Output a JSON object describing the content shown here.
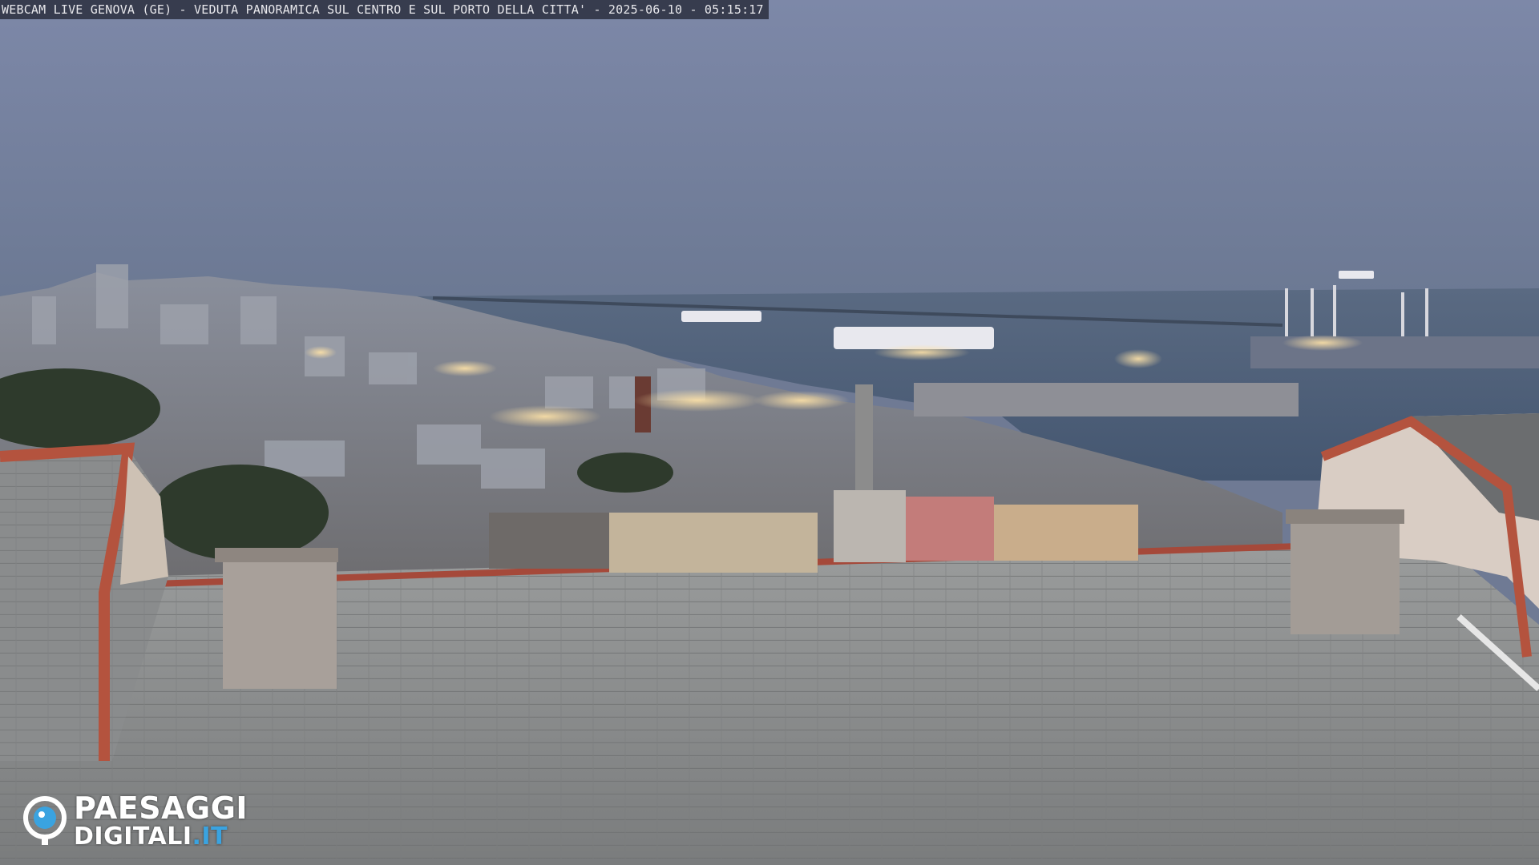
{
  "overlay": {
    "caption": "WEBCAM LIVE GENOVA (GE) - VEDUTA PANORAMICA SUL CENTRO E SUL PORTO DELLA CITTA' - 2025-06-10 - 05:15:17"
  },
  "logo": {
    "line1": "PAESAGGI",
    "line2_main": "DIGITALI",
    "line2_accent": ".IT",
    "icon": "camera-eye-icon"
  },
  "colors": {
    "sky_top": "#7c87a6",
    "sky_bottom": "#6a7791",
    "sea": "#4d5e76",
    "roof_tile": "#8f9192",
    "roof_edge": "#b4533e",
    "city_light": "#ffd89a",
    "logo_accent": "#3aa3e0"
  }
}
